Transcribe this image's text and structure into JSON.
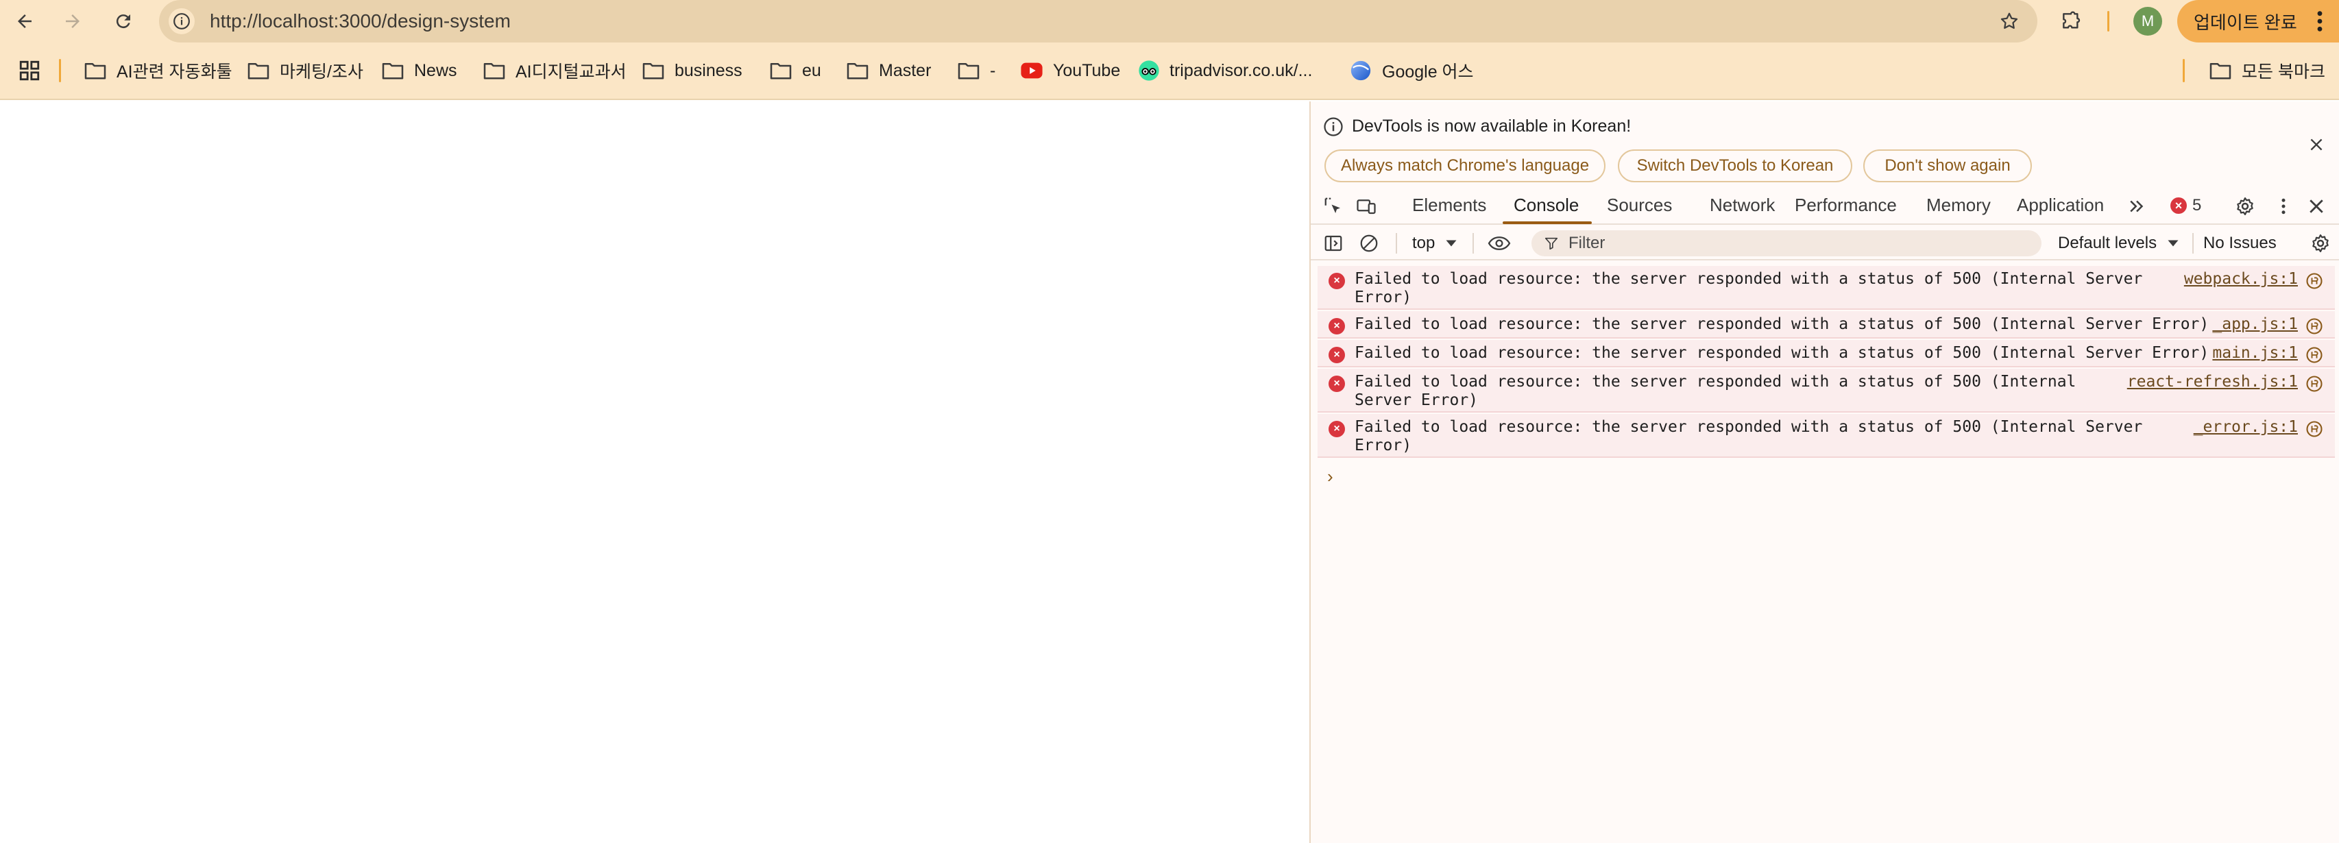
{
  "browser": {
    "url": "http://localhost:3000/design-system",
    "profile_initial": "M",
    "update_button": "업데이트 완료",
    "icons": {
      "back": "arrow-left-icon",
      "forward": "arrow-right-icon",
      "reload": "reload-icon",
      "site_info": "info-icon",
      "bookmark": "star-icon",
      "extensions": "puzzle-icon",
      "menu": "kebab-icon"
    }
  },
  "bookmarks": {
    "items": [
      {
        "label": "AI관련 자동화툴",
        "icon": "folder-icon"
      },
      {
        "label": "마케팅/조사",
        "icon": "folder-icon"
      },
      {
        "label": "News",
        "icon": "folder-icon"
      },
      {
        "label": "AI디지털교과서",
        "icon": "folder-icon"
      },
      {
        "label": "business",
        "icon": "folder-icon"
      },
      {
        "label": "eu",
        "icon": "folder-icon"
      },
      {
        "label": "Master",
        "icon": "folder-icon"
      },
      {
        "label": "-",
        "icon": "folder-icon"
      },
      {
        "label": "YouTube",
        "icon": "youtube-icon"
      },
      {
        "label": "tripadvisor.co.uk/...",
        "icon": "tripadvisor-icon"
      },
      {
        "label": "Google 어스",
        "icon": "google-earth-icon"
      }
    ],
    "all_bookmarks": "모든 북마크"
  },
  "devtools": {
    "banner": {
      "text": "DevTools is now available in Korean!",
      "buttons": [
        "Always match Chrome's language",
        "Switch DevTools to Korean",
        "Don't show again"
      ]
    },
    "tabs": [
      "Elements",
      "Console",
      "Sources",
      "Network",
      "Performance",
      "Memory",
      "Application"
    ],
    "active_tab": "Console",
    "error_count": "5",
    "console_toolbar": {
      "context": "top",
      "filter_placeholder": "Filter",
      "levels": "Default levels",
      "issues": "No Issues"
    },
    "messages": [
      {
        "text": "Failed to load resource: the server responded with a status of 500 (Internal Server\nError)",
        "source": "webpack.js:1"
      },
      {
        "text": "Failed to load resource: the server responded with a status of 500 (Internal Server Error)",
        "source": "_app.js:1"
      },
      {
        "text": "Failed to load resource: the server responded with a status of 500 (Internal Server Error)",
        "source": "main.js:1"
      },
      {
        "text": "Failed to load resource: the server responded with a status of 500 (Internal\nServer Error)",
        "source": "react-refresh.js:1"
      },
      {
        "text": "Failed to load resource: the server responded with a status of 500 (Internal Server\nError)",
        "source": "_error.js:1"
      }
    ],
    "prompt": "›"
  },
  "colors": {
    "chrome_bg": "#fbe6c6",
    "omnibox_bg": "#e9d2ad",
    "accent": "#f4ae52",
    "error": "#d9363e",
    "error_row_bg": "#fbeded"
  }
}
